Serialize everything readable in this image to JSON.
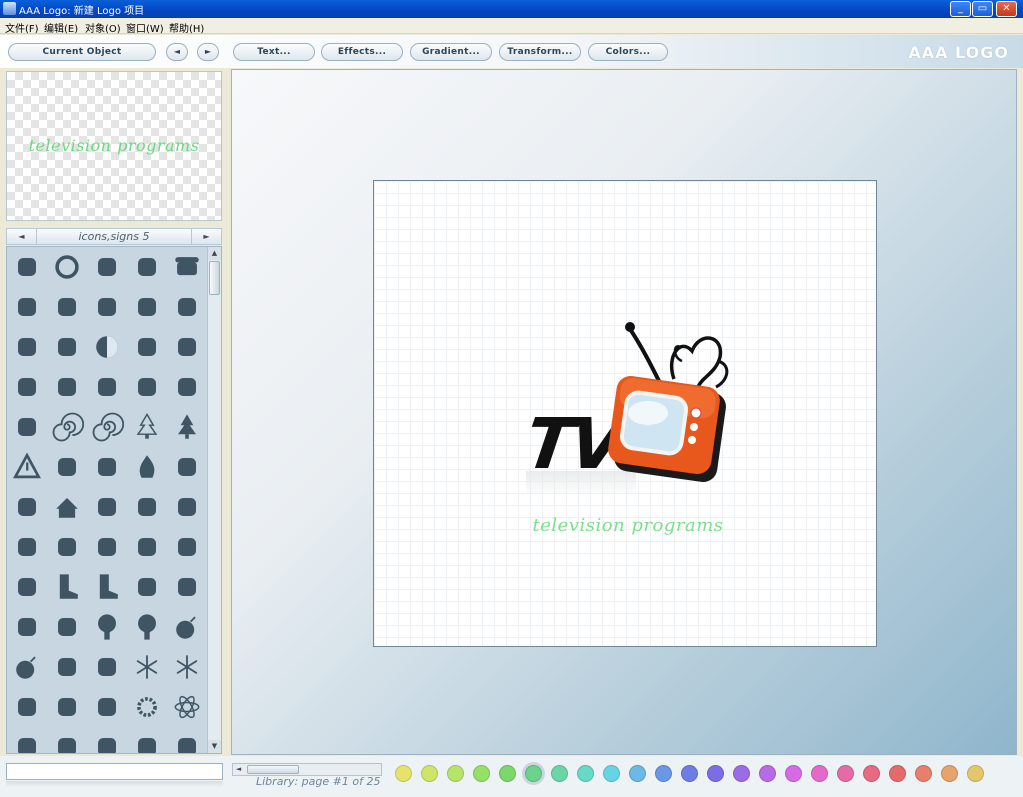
{
  "window": {
    "title": "AAA Logo: 新建 Logo 项目",
    "min_label": "_",
    "max_label": "▭",
    "close_label": "✕"
  },
  "menu": [
    {
      "label": "文件(F)"
    },
    {
      "label": "编辑(E)"
    },
    {
      "label": "对象(O)"
    },
    {
      "label": "窗口(W)"
    },
    {
      "label": "帮助(H)"
    }
  ],
  "toolbar": {
    "current_object": "Current Object",
    "prev": "◄",
    "next": "►",
    "text": "Text...",
    "effects": "Effects...",
    "gradient": "Gradient...",
    "transform": "Transform...",
    "colors": "Colors...",
    "brand": "AAA LOGO"
  },
  "preview": {
    "text": "television programs"
  },
  "library": {
    "prev": "◄",
    "next": "►",
    "category": "icons,signs 5",
    "page_info": "Library: page #1 of 25",
    "icons": [
      "triple-swirl-icon",
      "ring-icon",
      "swoosh-icon",
      "wave-icon",
      "telephone-icon",
      "coffee-cup-icon",
      "s-curve-icon",
      "teacup-icon",
      "gears-icon",
      "swirl-circle-icon",
      "wave-curl-icon",
      "no-smoking-icon",
      "globe-half-icon",
      "globe-map-icon",
      "hand-print-icon",
      "turtle-icon",
      "family-sign-icon",
      "flower-icon",
      "lion-mane-icon",
      "brick-wall-icon",
      "building-icon",
      "spiral-icon",
      "spiral-icon",
      "christmas-tree-icon",
      "pine-tree-icon",
      "warning-sign-icon",
      "handshake-icon",
      "fire-circle-icon",
      "flames-icon",
      "church-icon",
      "sun-house-icon",
      "house-icon",
      "wings-emblem-icon",
      "wings-icon",
      "palm-tree-icon",
      "female-symbol-icon",
      "male-symbol-icon",
      "paint-brush-icon",
      "brush-icon",
      "bus-icon",
      "vitruvian-man-icon",
      "boot-icon",
      "boot-icon",
      "arc-icon",
      "line-curve-icon",
      "sunglasses-icon",
      "necklace-icon",
      "tree-icon",
      "tree-icon",
      "bomb-icon",
      "bomb-icon",
      "high-heel-icon",
      "sunflower-icon",
      "snowflake-icon",
      "snowflake-icon",
      "family-icon",
      "parents-icon",
      "leaf-icon",
      "sun-gear-icon",
      "atom-icon",
      "leaf-wing-icon",
      "bead-ring-icon",
      "wings-v-icon",
      "tower-icon",
      "wave-shell-icon"
    ]
  },
  "canvas": {
    "logo_text": "TV",
    "slogan": "television programs"
  },
  "palette": [
    "#e6e36a",
    "#cfe468",
    "#b7e46a",
    "#96e067",
    "#7cd86a",
    "#6cd48a",
    "#68d6a6",
    "#67d9c6",
    "#66d4e3",
    "#6bb9e6",
    "#6a98e6",
    "#6c7ee3",
    "#7a6ee6",
    "#9a6ce6",
    "#b76be6",
    "#d56ae4",
    "#e46ac9",
    "#e56aa6",
    "#e66a84",
    "#e66a6c",
    "#e6806a",
    "#e6a36a",
    "#e6c66a"
  ],
  "palette_selected_index": 5
}
